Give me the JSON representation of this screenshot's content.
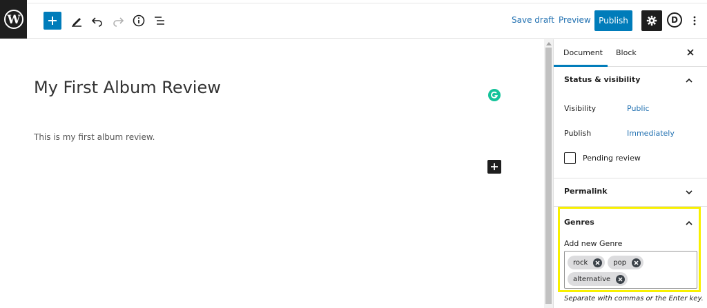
{
  "toolbar": {
    "save_draft": "Save draft",
    "preview": "Preview",
    "publish": "Publish",
    "avatar_letter": "D",
    "accent_color": "#007cba"
  },
  "editor": {
    "title": "My First Album Review",
    "paragraph": "This is my first album review."
  },
  "sidebar": {
    "tabs": [
      "Document",
      "Block"
    ],
    "close_icon": "close-icon",
    "status": {
      "title": "Status & visibility",
      "visibility_label": "Visibility",
      "visibility_value": "Public",
      "publish_label": "Publish",
      "publish_value": "Immediately",
      "pending_label": "Pending review",
      "pending_checked": false
    },
    "permalink": {
      "title": "Permalink"
    },
    "genres": {
      "title": "Genres",
      "add_label": "Add new Genre",
      "tokens": [
        "rock",
        "pop",
        "alternative"
      ],
      "helper": "Separate with commas or the Enter key.",
      "highlight_color": "#f8f000"
    }
  }
}
